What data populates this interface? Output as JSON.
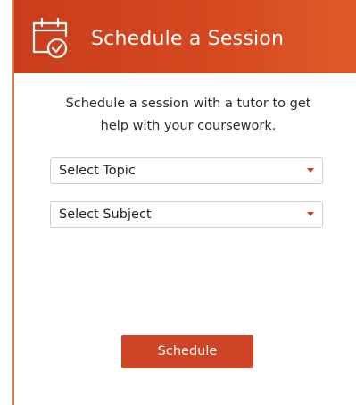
{
  "header": {
    "title": "Schedule a Session",
    "icon": "calendar-check-icon",
    "background_color": "#d4471f"
  },
  "main": {
    "description_line1": "Schedule a session with a tutor to get",
    "description_line2": "help with your coursework.",
    "topic_select": {
      "selected_label": "Select Topic"
    },
    "subject_select": {
      "selected_label": "Select Subject"
    },
    "schedule_button_label": "Schedule",
    "accent_color": "#cf4424"
  }
}
